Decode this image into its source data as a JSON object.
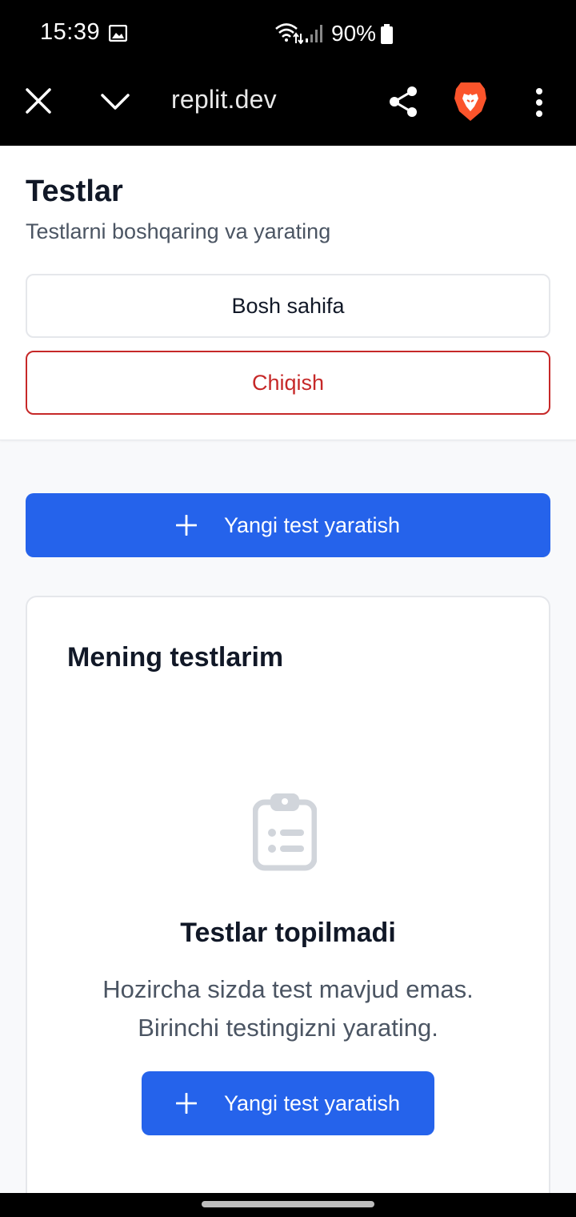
{
  "status_bar": {
    "time": "15:39",
    "battery": "90%",
    "icons": [
      "gallery-icon",
      "wifi-icon",
      "signal-icon",
      "battery-icon"
    ]
  },
  "browser": {
    "url": "replit.dev",
    "icons": [
      "close-icon",
      "chevron-down-icon",
      "share-icon",
      "brave-lion-icon",
      "more-vert-icon"
    ]
  },
  "header": {
    "title": "Testlar",
    "subtitle": "Testlarni boshqaring va yarating",
    "home_label": "Bosh sahifa",
    "logout_label": "Chiqish"
  },
  "create_button": {
    "label": "Yangi test yaratish",
    "icon": "plus-icon"
  },
  "card": {
    "title": "Mening testlarim",
    "empty_icon": "clipboard-list-icon",
    "empty_title": "Testlar topilmadi",
    "empty_desc_line1": "Hozircha sizda test mavjud emas.",
    "empty_desc_line2": "Birinchi testingizni yarating.",
    "button_label": "Yangi test yaratish"
  },
  "colors": {
    "primary": "#2563eb",
    "danger": "#c62828",
    "brave": "#fb542b"
  }
}
